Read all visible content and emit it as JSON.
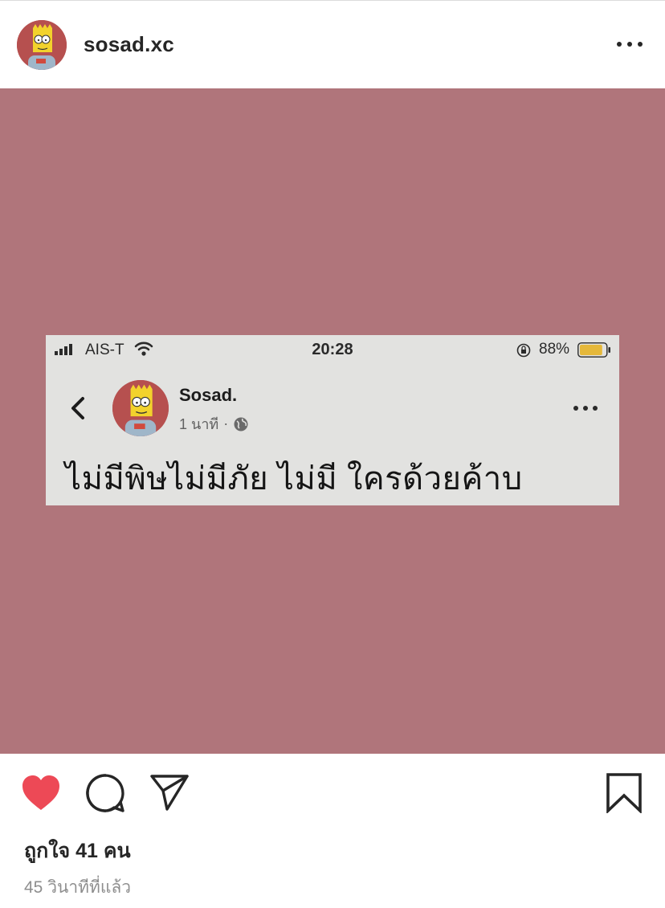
{
  "post": {
    "username": "sosad.xc",
    "likes_text": "ถูกใจ 41 คน",
    "timestamp": "45 วินาทีที่แล้ว"
  },
  "media": {
    "background_color": "#b0757b",
    "screenshot": {
      "status_bar": {
        "carrier": "AIS-T",
        "time": "20:28",
        "battery_percent": "88%",
        "battery_level": 0.88
      },
      "author": "Sosad.",
      "time_ago": "1 นาที",
      "separator": "·",
      "text": "ไม่มีพิษไม่มีภัย ไม่มี ใครด้วยค้าบ"
    }
  },
  "icons": {
    "more": "more-icon",
    "heart": "heart-icon",
    "comment": "comment-icon",
    "share": "share-icon",
    "bookmark": "bookmark-icon"
  },
  "colors": {
    "like_red": "#ed4956",
    "text_primary": "#262626",
    "text_secondary": "#8e8e8e"
  }
}
